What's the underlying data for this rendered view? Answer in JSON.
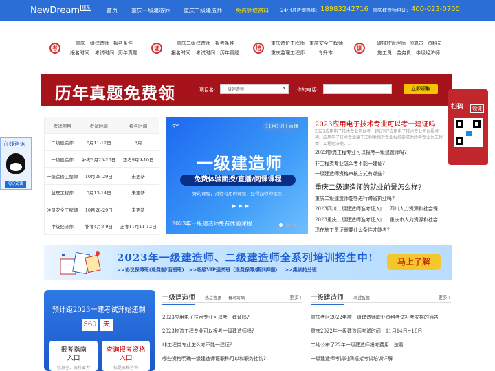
{
  "header": {
    "logo": "NewDream",
    "logo_badge": "纽东",
    "nav": [
      "首页",
      "重庆一级建造师",
      "重庆二级建造师",
      "免费领取资料"
    ],
    "hotline_label": "24小时咨询热线:",
    "hotline_number": "18983242716",
    "training_label": "重庆建造师培训:",
    "training_number": "400-023-0700",
    "accent_color": "#2b6fd6",
    "highlight_color": "#ffe000"
  },
  "categories": [
    {
      "icon": "考",
      "links": [
        "重庆一级建造师",
        "报名条件",
        "报名时间",
        "考试时间",
        "历年真题"
      ]
    },
    {
      "icon": "证",
      "links": [
        "重庆二级建造师",
        "报考条件",
        "报名时间",
        "考试时间",
        "历年真题"
      ]
    },
    {
      "icon": "培",
      "links": [
        "重庆造价工程师",
        "重庆安全工程师",
        "重庆监理工程师",
        "专升本"
      ]
    },
    {
      "icon": "训",
      "links": [
        "碳排放管理师",
        "预算员",
        "资料员",
        "施工员",
        "劳务员",
        "中级经济师"
      ]
    }
  ],
  "signup_banner": {
    "title": "历年真题免费领",
    "project_label": "项目名:",
    "project_value": "一级建造师",
    "phone_label": "你的电话:",
    "button": "立即领取",
    "bg_color": "#a6131b"
  },
  "schedule": {
    "headers": [
      "考试项目",
      "考试时间",
      "报名时间"
    ],
    "rows": [
      [
        "二级建造师",
        "6月11-12日",
        "3月"
      ],
      [
        "一级建造师",
        "补考3月25-26日",
        "正考9月9-10日"
      ],
      [
        "一级造价工程师",
        "10月28-29日",
        "未更新"
      ],
      [
        "监理工程师",
        "5月13-14日",
        "未更新"
      ],
      [
        "注册安全工程师",
        "10月28-29日",
        "未更新"
      ],
      [
        "中级经济师",
        "补考4月8-9日",
        "正考11月11-12日"
      ]
    ]
  },
  "promo": {
    "tag": "SY.",
    "date": "11月19日 直播",
    "title": "一级建造师",
    "ribbon": "免费体验面授/直播/阅课课程",
    "subtitle": "好的课程，对你有用的课程，经得起你的试探!",
    "footer": "2023年一级建造师免费体验课程"
  },
  "news": {
    "headline1": "2023应用电子技术专业可以考一建证吗",
    "summary1": "2023应用电子技术专业可以考一建证吗?应用电子技术专业可以报考一建。应用电子技术专业属于工程类相近专业报名要求为所学专业为工程类、工程经济类、...",
    "items1": [
      "2023物流工程专业可以报考一级建造师吗?",
      "非工程类专业怎么考不能一建证?",
      "一级建造师资格审核方式有哪些?"
    ],
    "headline2": "重庆二级建造师的就业前景怎么样?",
    "items2": [
      "重庆二级建造师能够进行跨省执业吗?",
      "2023四川二级建造师准考证入口：四川人力资源和社会保",
      "2023重庆二级建造师准考证入口：重庆市人力资源和社会",
      "现在施工员证需要什么条件才能考?"
    ]
  },
  "qr": {
    "title": "扫码",
    "tag": "领课"
  },
  "online": {
    "title": "在线咨询",
    "button": "QQ交谈"
  },
  "training_banner": {
    "title": "2023年一级建造师、二级建造师全系列培训招生中!",
    "links": [
      ">>协议保障班(退费制/面授班)",
      ">>超级VIP通关班（退费保障/集训押题）",
      ">>集训抢分班"
    ],
    "cta": "马上了解"
  },
  "countdown": {
    "title": "预计距2023一建考试开始还剩",
    "days": "560",
    "unit": "天",
    "buttons": [
      {
        "title": "报考指南\n入口",
        "sub": "信息全、资料省力"
      },
      {
        "title": "查询报考资格\n入口",
        "sub": "仅是资格咨询"
      }
    ]
  },
  "col1": {
    "title": "一级建造师",
    "tabs": [
      "热点资讯",
      "备考攻略"
    ],
    "more": "更多+",
    "items": [
      "2023应用电子技术专业可以考一建证吗?",
      "2023物流工程专业可以报考一级建造师吗?",
      "非工程类专业怎么考不能一建证?",
      "哪些资格明确一级建造师证职称可以和职务挂钩?"
    ]
  },
  "col2": {
    "title": "一级建造师",
    "tabs": [
      "考试政策"
    ],
    "more": "更多+",
    "items": [
      "重庆考区2022年度一级建造师职业资格考试补考安排的通告",
      "重庆2022年一级建造师考试时间：11月14日~18日",
      "二地公布了22年一级建造师报考费用，速看",
      "一级建造师考试时间框架考试培训详解"
    ]
  }
}
